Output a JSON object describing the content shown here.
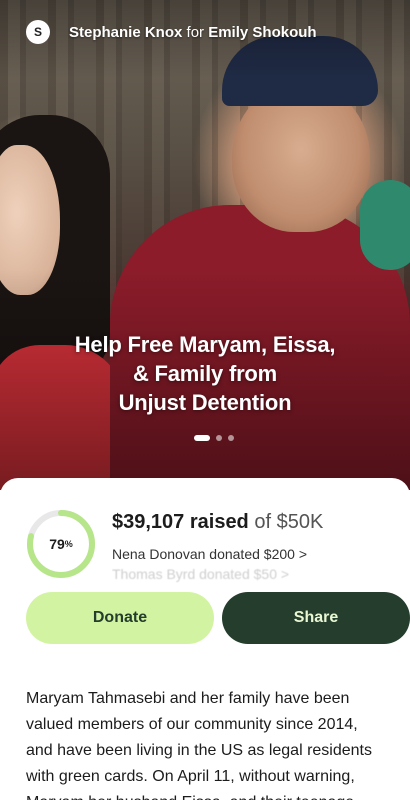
{
  "organizer": {
    "avatar_initial": "S",
    "name": "Stephanie Knox",
    "connector": "for",
    "beneficiary": "Emily Shokouh"
  },
  "hero": {
    "title_line1": "Help Free Maryam, Eissa,",
    "title_line2": "& Family from",
    "title_line3": "Unjust Detention",
    "carousel_total": 3,
    "carousel_active": 1
  },
  "progress": {
    "percent_number": "79",
    "percent_sign": "%",
    "fraction": 0.79,
    "ring_color": "#b7e58a",
    "track_color": "#e8e8e8"
  },
  "raised": {
    "amount": "$39,107 raised",
    "of_goal": "of $50K"
  },
  "donations": [
    "Nena Donovan donated $200 >",
    "Thomas Byrd donated $50 >"
  ],
  "actions": {
    "donate_label": "Donate",
    "share_label": "Share"
  },
  "story": {
    "text": "Maryam Tahmasebi and her family have been\nvalued members of our community since 2014,\nand have been living in the US as legal residents\nwith green cards. On April 11, without warning,\nMaryam her husband Eissa, and their teenage"
  },
  "colors": {
    "donate_bg": "#d2f4a2",
    "share_bg": "#243d2c",
    "share_text": "#e9f7d3"
  }
}
